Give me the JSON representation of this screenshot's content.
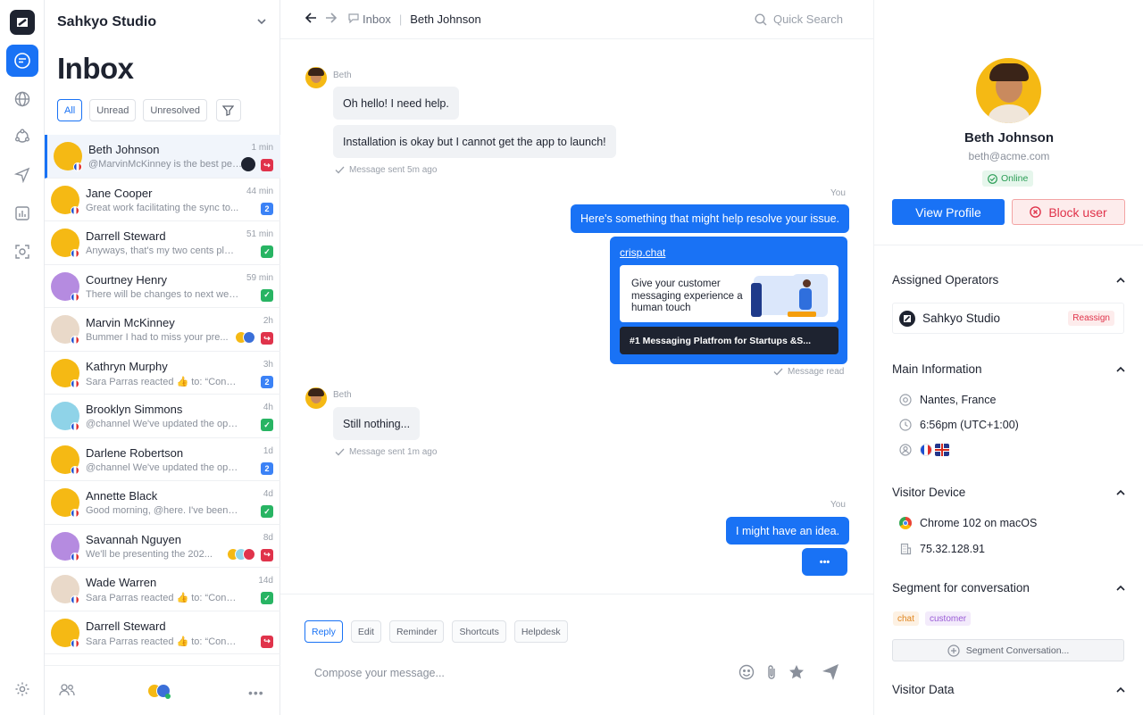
{
  "workspace": {
    "name": "Sahkyo Studio"
  },
  "list": {
    "title": "Inbox",
    "filters": [
      "All",
      "Unread",
      "Unresolved"
    ],
    "conversations": [
      {
        "name": "Beth Johnson",
        "preview": "@MarvinMcKinney is the best per...",
        "time": "1 min",
        "badge": "↪",
        "badge_color": "red",
        "avatar_color": "#f5b914"
      },
      {
        "name": "Jane Cooper",
        "preview": "Great work facilitating the sync to...",
        "time": "44 min",
        "badge": "2",
        "badge_color": "blue",
        "avatar_color": "#f5b914"
      },
      {
        "name": "Darrell Steward",
        "preview": "Anyways, that's my two cents plan...",
        "time": "51 min",
        "badge": "✓",
        "badge_color": "green",
        "avatar_color": "#f5b914"
      },
      {
        "name": "Courtney Henry",
        "preview": "There will be changes to next wee...",
        "time": "59 min",
        "badge": "✓",
        "badge_color": "green",
        "avatar_color": "#b58be0"
      },
      {
        "name": "Marvin McKinney",
        "preview": "Bummer I had to miss your pre...",
        "time": "2h",
        "badge": "↪",
        "badge_color": "red",
        "avatar_color": "#e9d9c9"
      },
      {
        "name": "Kathryn Murphy",
        "preview": "Sara Parras reacted 👍 to: “Congratula...",
        "time": "3h",
        "badge": "2",
        "badge_color": "blue",
        "avatar_color": "#f5b914"
      },
      {
        "name": "Brooklyn Simmons",
        "preview": "@channel We've updated the open en...",
        "time": "4h",
        "badge": "✓",
        "badge_color": "green",
        "avatar_color": "#8fd3e8"
      },
      {
        "name": "Darlene Robertson",
        "preview": "@channel We've updated the open en...",
        "time": "1d",
        "badge": "2",
        "badge_color": "blue",
        "avatar_color": "#f5b914"
      },
      {
        "name": "Annette Black",
        "preview": "Good morning, @here. I've been havin...",
        "time": "4d",
        "badge": "✓",
        "badge_color": "green",
        "avatar_color": "#f5b914"
      },
      {
        "name": "Savannah Nguyen",
        "preview": "We'll be presenting the 202...",
        "time": "8d",
        "badge": "↪",
        "badge_color": "red",
        "avatar_color": "#b58be0"
      },
      {
        "name": "Wade Warren",
        "preview": "Sara Parras reacted 👍 to: “Congratul...",
        "time": "14d",
        "badge": "✓",
        "badge_color": "green",
        "avatar_color": "#e9d9c9"
      },
      {
        "name": "Darrell Steward",
        "preview": "Sara Parras reacted 👍 to: “Congratula...",
        "time": "",
        "badge": "↪",
        "badge_color": "red",
        "avatar_color": "#f5b914"
      }
    ]
  },
  "header": {
    "breadcrumb_inbox": "Inbox",
    "breadcrumb_contact": "Beth Johnson",
    "search_placeholder": "Quick Search"
  },
  "messages": {
    "sender_beth": "Beth",
    "sender_you": "You",
    "m1": "Oh hello! I need help.",
    "m2": "Installation is okay but I cannot get the app to launch!",
    "m2_meta": "Message sent 5m ago",
    "m3": "Here's something that might help resolve your issue.",
    "card_link": "crisp.chat",
    "card_text": "Give your customer messaging experience a human touch",
    "card_title": "#1 Messaging Platfrom for Startups &S...",
    "m3_meta": "Message read",
    "m4": "Still nothing...",
    "m4_meta": "Message sent 1m ago",
    "m5": "I might have an idea.",
    "typing": "•••"
  },
  "compose": {
    "tabs": [
      "Reply",
      "Edit",
      "Reminder",
      "Shortcuts",
      "Helpdesk"
    ],
    "placeholder": "Compose your message..."
  },
  "profile": {
    "name": "Beth Johnson",
    "email": "beth@acme.com",
    "status": "Online",
    "view_profile": "View Profile",
    "block_user": "Block user"
  },
  "sections": {
    "assigned_operators": "Assigned Operators",
    "operator_name": "Sahkyo Studio",
    "reassign": "Reassign",
    "main_information": "Main Information",
    "location": "Nantes, France",
    "local_time": "6:56pm (UTC+1:00)",
    "visitor_device": "Visitor Device",
    "browser": "Chrome 102 on macOS",
    "ip": "75.32.128.91",
    "segment": "Segment for conversation",
    "tags": [
      "chat",
      "customer"
    ],
    "segment_button": "Segment Conversation...",
    "visitor_data": "Visitor Data"
  },
  "colors": {
    "accent": "#1972f5",
    "danger": "#e0334b",
    "success": "#28b463",
    "tag_chat": "#f0a13b",
    "tag_customer": "#9a5bd6"
  }
}
